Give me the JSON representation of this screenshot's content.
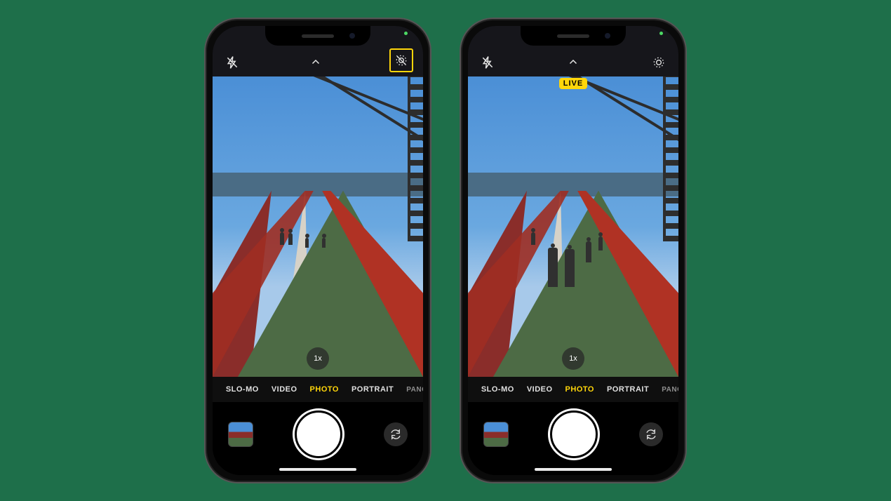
{
  "phones": [
    {
      "live_off": true,
      "live_indicator_highlight": true,
      "live_badge": null,
      "zoom": "1x",
      "modes": [
        "SLO-MO",
        "VIDEO",
        "PHOTO",
        "PORTRAIT",
        "PANO"
      ],
      "active_mode": "PHOTO",
      "scene_people": "far"
    },
    {
      "live_off": false,
      "live_indicator_highlight": false,
      "live_badge": "LIVE",
      "zoom": "1x",
      "modes": [
        "SLO-MO",
        "VIDEO",
        "PHOTO",
        "PORTRAIT",
        "PANO"
      ],
      "active_mode": "PHOTO",
      "scene_people": "near"
    }
  ],
  "colors": {
    "accent": "#ffd60a"
  }
}
